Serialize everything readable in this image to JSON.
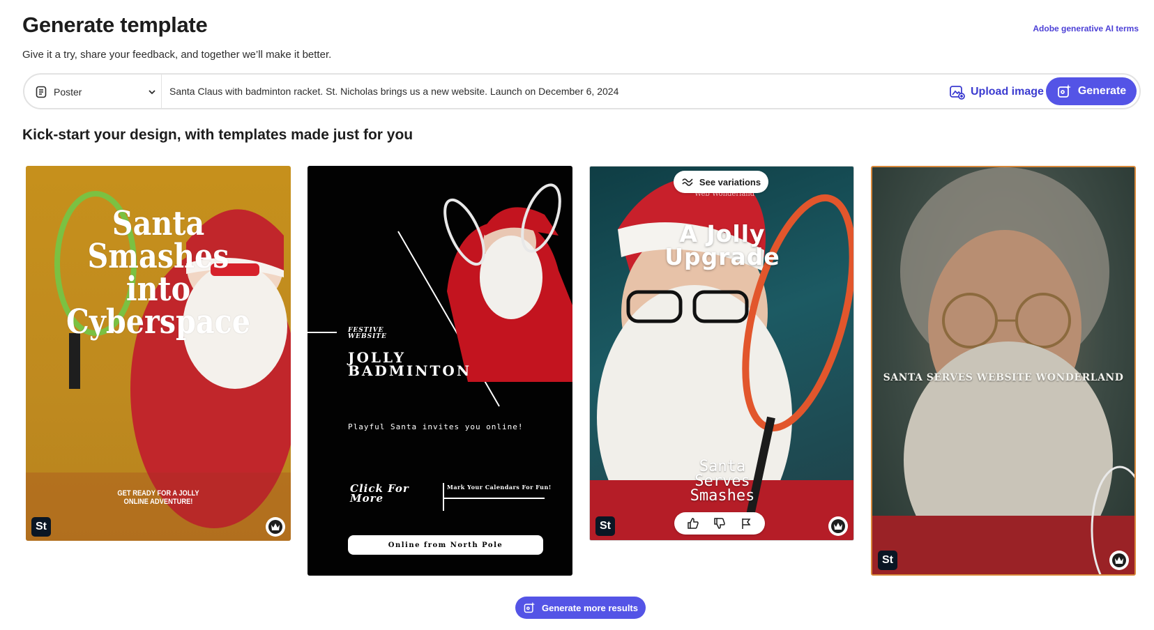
{
  "header": {
    "title": "Generate template",
    "subtitle": "Give it a try, share your feedback, and together we’ll make it better.",
    "terms_link": "Adobe generative AI terms"
  },
  "prompt_bar": {
    "type_select": {
      "selected": "Poster",
      "icon": "document-icon"
    },
    "prompt_value": "Santa Claus with badminton racket. St. Nicholas brings us a new website. Launch on December 6, 2024",
    "upload_label": "Upload image",
    "generate_label": "Generate"
  },
  "section_title": "Kick-start your design, with templates made just for you",
  "templates": [
    {
      "title": "Santa Smashes into Cyberspace",
      "title_lines": [
        "Santa",
        "Smashes",
        "into",
        "Cyberspace"
      ],
      "cta_lines": [
        "GET READY FOR A JOLLY",
        "ONLINE ADVENTURE!"
      ],
      "badge": "St"
    },
    {
      "festive_lines": [
        "FESTIVE",
        "WEBSITE"
      ],
      "title_lines": [
        "JOLLY",
        "BADMINTON"
      ],
      "invite": "Playful Santa invites you online!",
      "click_lines": [
        "Click For",
        "More"
      ],
      "calendar": "Mark Your Calendars For Fun!",
      "online": "Online from North Pole"
    },
    {
      "variations_label": "See variations",
      "web_text": "Web Wonderland",
      "title_lines": [
        "A Jolly",
        "Upgrade"
      ],
      "sub_lines": [
        "Santa",
        "Serves",
        "Smashes"
      ],
      "badge": "St"
    },
    {
      "title": "SANTA SERVES WEBSITE WONDERLAND",
      "badge": "St"
    }
  ],
  "more_results_label": "Generate more results",
  "colors": {
    "accent": "#5454e6",
    "link": "#4b3fd6",
    "stock_badge": "#0a1624"
  }
}
